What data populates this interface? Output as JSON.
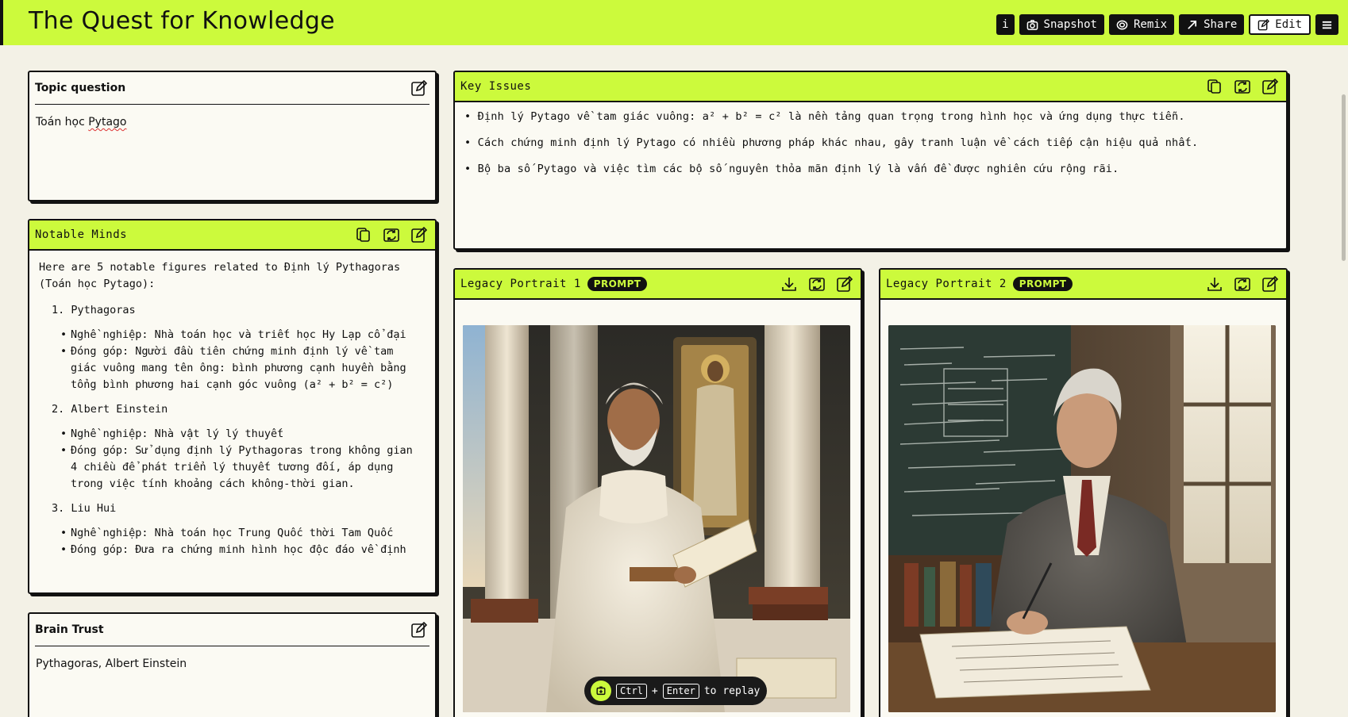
{
  "app": {
    "title": "The Quest for Knowledge"
  },
  "toolbar": {
    "info_label": "i",
    "snapshot_label": "Snapshot",
    "remix_label": "Remix",
    "share_label": "Share",
    "edit_label": "Edit"
  },
  "topic": {
    "title": "Topic question",
    "value_prefix": "Toán học ",
    "value_flagged": "Pytago"
  },
  "notable_minds": {
    "title": "Notable Minds",
    "intro": "Here are 5 notable figures related to Định lý Pythagoras (Toán học Pytago):",
    "figures": [
      {
        "name": "1. Pythagoras",
        "occupation": "Nghề nghiệp: Nhà toán học và triết học Hy Lạp cổ đại",
        "contribution": "Đóng góp: Người đầu tiên chứng minh định lý về tam giác vuông mang tên ông: bình phương cạnh huyền bằng tổng bình phương hai cạnh góc vuông (a² + b² = c²)"
      },
      {
        "name": "2. Albert Einstein",
        "occupation": "Nghề nghiệp: Nhà vật lý lý thuyết",
        "contribution": "Đóng góp: Sử dụng định lý Pythagoras trong không gian 4 chiều để phát triển lý thuyết tương đối, áp dụng trong việc tính khoảng cách không-thời gian."
      },
      {
        "name": "3. Liu Hui",
        "occupation": "Nghề nghiệp: Nhà toán học Trung Quốc thời Tam Quốc",
        "contribution": "Đóng góp: Đưa ra chứng minh hình học độc đáo về định"
      }
    ]
  },
  "brain_trust": {
    "title": "Brain Trust",
    "value": "Pythagoras, Albert Einstein"
  },
  "key_issues": {
    "title": "Key Issues",
    "items": [
      "• Định lý Pytago về tam giác vuông: a² + b² = c² là nền tảng quan trọng trong hình học và ứng dụng thực tiễn.",
      "• Cách chứng minh định lý Pytago có nhiều phương pháp khác nhau, gây tranh luận về cách tiếp cận hiệu quả nhất.",
      "• Bộ ba số Pytago và việc tìm các bộ số nguyên thỏa mãn định lý là vấn đề được nghiên cứu rộng rãi."
    ]
  },
  "portraits": [
    {
      "title": "Legacy Portrait 1",
      "badge": "PROMPT"
    },
    {
      "title": "Legacy Portrait 2",
      "badge": "PROMPT"
    }
  ],
  "replay_hint": {
    "key1": "Ctrl",
    "plus": "+",
    "key2": "Enter",
    "text": "to replay"
  },
  "colors": {
    "accent": "#ccfa3c",
    "ink": "#111111",
    "page": "#f3f1e6",
    "card": "#fbfaf3"
  }
}
